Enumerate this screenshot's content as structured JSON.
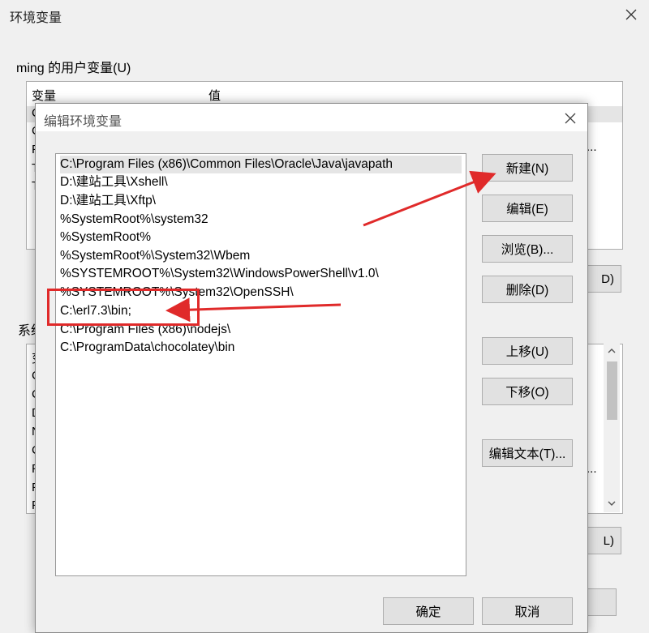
{
  "outer": {
    "title": "环境变量",
    "user_group_label": "ming 的用户变量(U)",
    "col_variable": "变量",
    "col_value": "值",
    "user_rows_visible": [
      "C",
      "C",
      "P",
      "T",
      "T"
    ],
    "user_right_button_partial": "D)",
    "sys_group_label_partial": "系统",
    "sys_rows_visible": [
      "变",
      "C",
      "C",
      "D",
      "N",
      "C",
      "P",
      "P",
      "P"
    ],
    "sys_right_button_partial": "L)",
    "ellipsis": "..."
  },
  "dialog": {
    "title": "编辑环境变量",
    "paths": [
      "C:\\Program Files (x86)\\Common Files\\Oracle\\Java\\javapath",
      "D:\\建站工具\\Xshell\\",
      "D:\\建站工具\\Xftp\\",
      "%SystemRoot%\\system32",
      "%SystemRoot%",
      "%SystemRoot%\\System32\\Wbem",
      "%SYSTEMROOT%\\System32\\WindowsPowerShell\\v1.0\\",
      "%SYSTEMROOT%\\System32\\OpenSSH\\",
      "C:\\erl7.3\\bin;",
      "C:\\Program Files (x86)\\nodejs\\",
      "C:\\ProgramData\\chocolatey\\bin"
    ],
    "buttons": {
      "new": "新建(N)",
      "edit": "编辑(E)",
      "browse": "浏览(B)...",
      "delete": "删除(D)",
      "move_up": "上移(U)",
      "move_down": "下移(O)",
      "edit_text": "编辑文本(T)...",
      "ok": "确定",
      "cancel": "取消"
    }
  },
  "annotation": {
    "color": "#e02a2a"
  }
}
